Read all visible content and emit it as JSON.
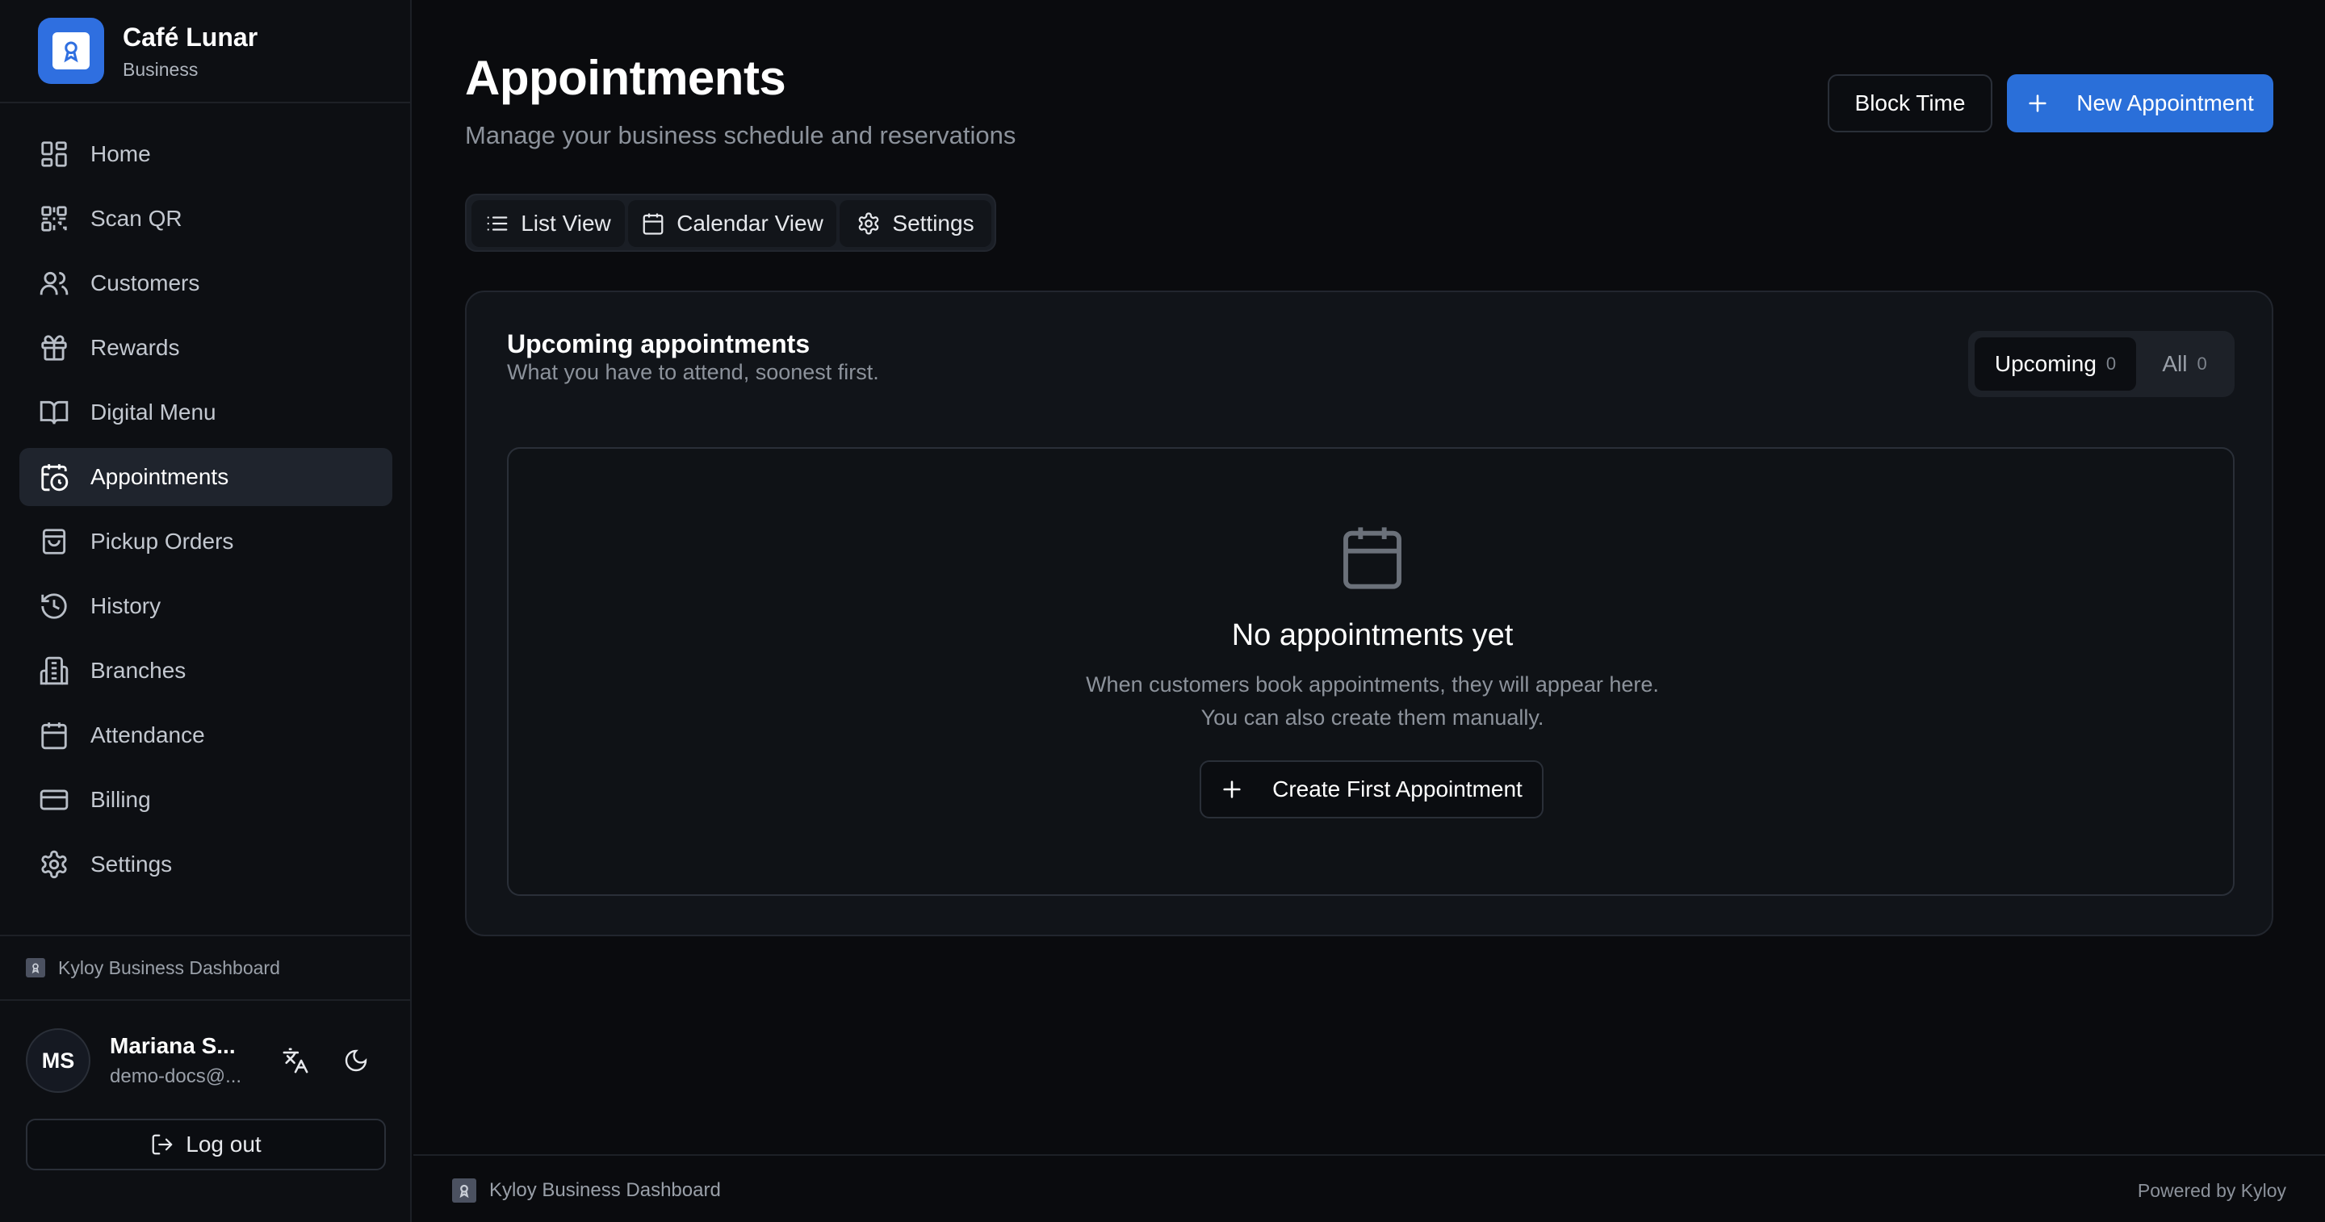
{
  "brand": {
    "name": "Café Lunar",
    "subtitle": "Business"
  },
  "nav": [
    {
      "label": "Home",
      "icon": "grid-icon",
      "active": false
    },
    {
      "label": "Scan QR",
      "icon": "qr-code-icon",
      "active": false
    },
    {
      "label": "Customers",
      "icon": "users-icon",
      "active": false
    },
    {
      "label": "Rewards",
      "icon": "gift-icon",
      "active": false
    },
    {
      "label": "Digital Menu",
      "icon": "book-open-icon",
      "active": false
    },
    {
      "label": "Appointments",
      "icon": "calendar-clock-icon",
      "active": true
    },
    {
      "label": "Pickup Orders",
      "icon": "shopping-bag-icon",
      "active": false
    },
    {
      "label": "History",
      "icon": "history-icon",
      "active": false
    },
    {
      "label": "Branches",
      "icon": "building-icon",
      "active": false
    },
    {
      "label": "Attendance",
      "icon": "calendar-icon",
      "active": false
    },
    {
      "label": "Billing",
      "icon": "credit-card-icon",
      "active": false
    },
    {
      "label": "Settings",
      "icon": "gear-icon",
      "active": false
    }
  ],
  "sidebar_footer": {
    "label": "Kyloy Business Dashboard"
  },
  "user": {
    "initials": "MS",
    "name": "Mariana S...",
    "email": "demo-docs@...",
    "logout_label": "Log out"
  },
  "header": {
    "title": "Appointments",
    "subtitle": "Manage your business schedule and reservations",
    "block_time_label": "Block Time",
    "new_appointment_label": "New Appointment"
  },
  "tabs": [
    {
      "label": "List View",
      "icon": "list-icon"
    },
    {
      "label": "Calendar View",
      "icon": "calendar-icon"
    },
    {
      "label": "Settings",
      "icon": "gear-icon"
    }
  ],
  "card": {
    "title": "Upcoming appointments",
    "subtitle": "What you have to attend, soonest first.",
    "filters": [
      {
        "label": "Upcoming",
        "count": "0",
        "active": true
      },
      {
        "label": "All",
        "count": "0",
        "active": false
      }
    ],
    "empty": {
      "title": "No appointments yet",
      "line1": "When customers book appointments, they will appear here.",
      "line2": "You can also create them manually.",
      "button_label": "Create First Appointment"
    }
  },
  "footer": {
    "left": "Kyloy Business Dashboard",
    "right": "Powered by Kyloy"
  },
  "colors": {
    "accent": "#2a6fd9",
    "background": "#0a0b0e",
    "card": "#111419"
  }
}
